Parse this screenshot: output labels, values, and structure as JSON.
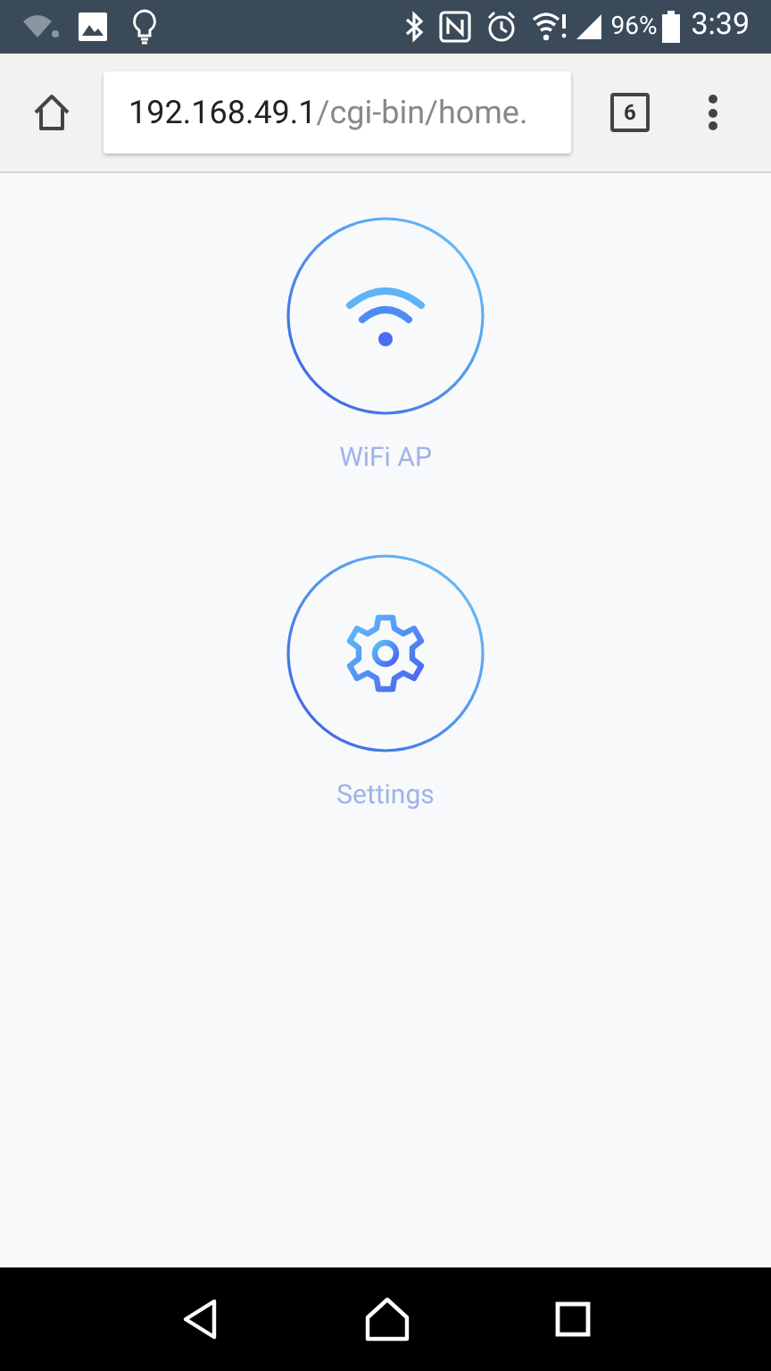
{
  "status_bar": {
    "battery": "96%",
    "time": "3:39"
  },
  "browser": {
    "url_host": "192.168.49.1",
    "url_path": "/cgi-bin/home.",
    "tab_count": "6"
  },
  "menu": [
    {
      "kind": "wifi",
      "label": "WiFi AP"
    },
    {
      "kind": "settings",
      "label": "Settings"
    }
  ]
}
